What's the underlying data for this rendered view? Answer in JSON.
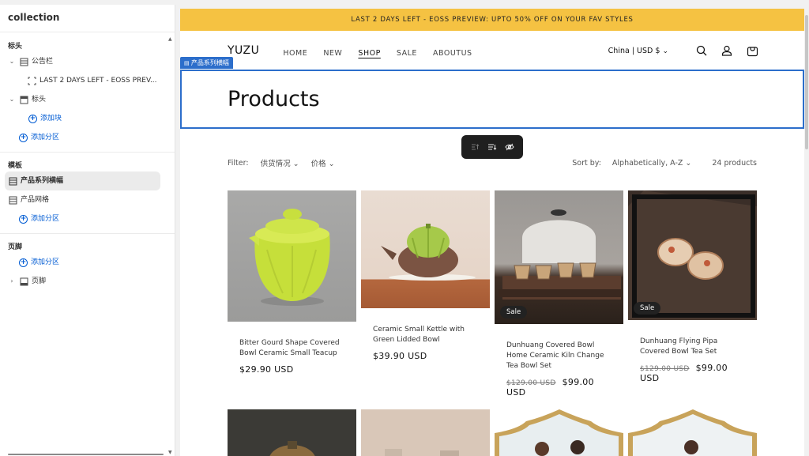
{
  "sidebar": {
    "title": "collection",
    "header_section": {
      "heading": "标头",
      "items": [
        {
          "label": "公告栏",
          "icon": "section-icon",
          "expandable": true
        },
        {
          "label": "LAST 2 DAYS LEFT - EOSS PREV...",
          "icon": "block-icon",
          "indent": true
        },
        {
          "label": "标头",
          "icon": "header-icon",
          "expandable": true
        }
      ],
      "add_block": "添加块",
      "add_section": "添加分区"
    },
    "template_section": {
      "heading": "模板",
      "items": [
        {
          "label": "产品系列横幅",
          "icon": "section-icon",
          "selected": true
        },
        {
          "label": "产品网格",
          "icon": "section-icon"
        }
      ],
      "add_section": "添加分区"
    },
    "footer_section": {
      "heading": "页脚",
      "add_section": "添加分区",
      "items": [
        {
          "label": "页脚",
          "icon": "footer-icon",
          "expandable": true
        }
      ]
    }
  },
  "preview": {
    "announcement": "LAST 2 DAYS LEFT - EOSS PREVIEW: UPTO 50% OFF ON YOUR FAV STYLES",
    "logo": "YUZU",
    "nav": [
      "HOME",
      "NEW",
      "SHOP",
      "SALE",
      "ABOUTUS"
    ],
    "active_nav": "SHOP",
    "locale": "China | USD $",
    "section_tag": "产品系列横幅",
    "page_heading": "Products",
    "filter": {
      "label": "Filter:",
      "availability": "供货情况",
      "price": "价格",
      "sort_label": "Sort by:",
      "sort_value": "Alphabetically, A-Z",
      "count": "24 products"
    },
    "products": [
      {
        "title": "Bitter Gourd Shape Covered Bowl Ceramic Small Teacup",
        "price": "$29.90 USD",
        "compare": "",
        "sale": ""
      },
      {
        "title": "Ceramic Small Kettle with Green Lidded Bowl",
        "price": "$39.90 USD",
        "compare": "",
        "sale": ""
      },
      {
        "title": "Dunhuang Covered Bowl Home Ceramic Kiln Change Tea Bowl Set",
        "price": "$99.00 USD",
        "compare": "$129.00 USD",
        "sale": "Sale"
      },
      {
        "title": "Dunhuang Flying Pipa Covered Bowl Tea Set",
        "price": "$99.00 USD",
        "compare": "$129.00 USD",
        "sale": "Sale"
      }
    ]
  },
  "colors": {
    "announcement_bg": "#f5c242",
    "selection_blue": "#2c6ecb",
    "link_blue": "#005bd3"
  }
}
